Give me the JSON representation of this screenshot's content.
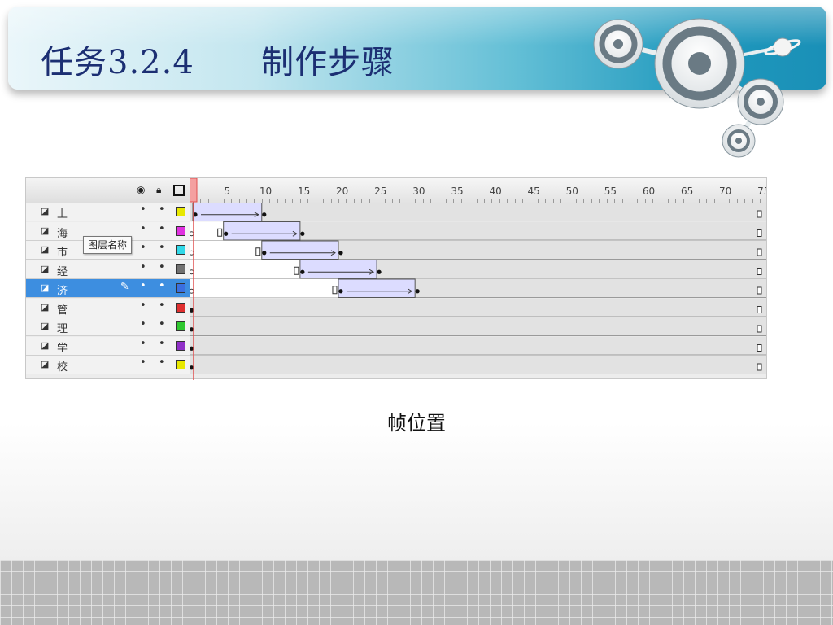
{
  "slide": {
    "title": "任务3.2.4      制作步骤",
    "caption": "帧位置"
  },
  "timeline": {
    "header_icons": [
      "eye-icon",
      "lock-icon",
      "outline-icon"
    ],
    "ruler_ticks": [
      "1",
      "5",
      "10",
      "15",
      "20",
      "25",
      "30",
      "35",
      "40",
      "45",
      "50",
      "55",
      "60",
      "65",
      "70",
      "75"
    ],
    "tooltip": "图层名称",
    "layers": [
      {
        "name": "上",
        "color": "#e8e800",
        "tween_start": 1,
        "tween_end": 10,
        "selected": false
      },
      {
        "name": "海",
        "color": "#e030e0",
        "tween_start": 5,
        "tween_end": 15,
        "selected": false
      },
      {
        "name": "市",
        "color": "#30d8e8",
        "tween_start": 10,
        "tween_end": 20,
        "selected": false
      },
      {
        "name": "经",
        "color": "#707070",
        "tween_start": 15,
        "tween_end": 25,
        "selected": false
      },
      {
        "name": "济",
        "color": "#3a6fe0",
        "tween_start": 20,
        "tween_end": 30,
        "selected": true
      },
      {
        "name": "管",
        "color": "#e03030",
        "tween_start": null,
        "tween_end": null,
        "selected": false
      },
      {
        "name": "理",
        "color": "#30c830",
        "tween_start": null,
        "tween_end": null,
        "selected": false
      },
      {
        "name": "学",
        "color": "#9030c8",
        "tween_start": null,
        "tween_end": null,
        "selected": false
      },
      {
        "name": "校",
        "color": "#e8e800",
        "tween_start": null,
        "tween_end": null,
        "selected": false
      }
    ],
    "colors": {
      "tween_fill": "#dcdcff",
      "playhead": "#e05050",
      "selected_row": "#3d8ee0"
    }
  }
}
